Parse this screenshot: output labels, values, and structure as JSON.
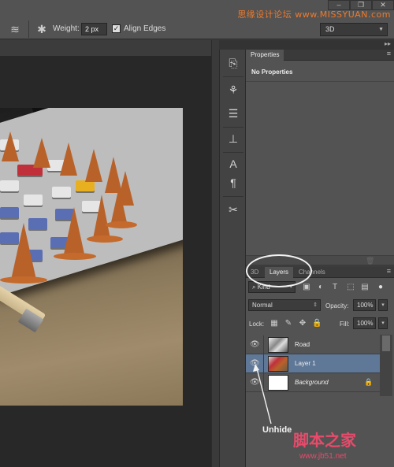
{
  "watermark_top": "思缘设计论坛 www.MISSYUAN.com",
  "options": {
    "weight_label": "Weight:",
    "weight_value": "2 px",
    "align_edges_checked": true,
    "align_edges_label": "Align Edges",
    "mode_select": "3D"
  },
  "tool_icons": [
    "layer-stack-icon",
    "gear-icon"
  ],
  "side_icons": [
    "history-icon",
    "brush-icon",
    "brush-presets-icon",
    "clone-source-icon",
    "character-icon",
    "paragraph-icon",
    "tools-icon"
  ],
  "properties": {
    "tab": "Properties",
    "title": "No Properties"
  },
  "layers_panel": {
    "tabs": [
      "3D",
      "Layers",
      "Channels"
    ],
    "active_tab": "Layers",
    "filter": "Kind",
    "blend_mode": "Normal",
    "opacity_label": "Opacity:",
    "opacity": "100%",
    "lock_label": "Lock:",
    "fill_label": "Fill:",
    "fill": "100%",
    "layers": [
      {
        "name": "Road",
        "visible": true,
        "selected": false
      },
      {
        "name": "Layer 1",
        "visible": true,
        "selected": true
      },
      {
        "name": "Background",
        "visible": true,
        "selected": false,
        "locked": true
      }
    ]
  },
  "annotation": {
    "callout": "Unhide"
  },
  "watermark_bottom": "脚本之家",
  "watermark_bottom_url": "www.jb51.net",
  "colors": {
    "panel_bg": "#535353",
    "selected_layer": "#5f7897",
    "annotation": "#f2f2f2",
    "watermark_top": "#ee7a2c",
    "watermark_bottom": "#e74b6b"
  }
}
